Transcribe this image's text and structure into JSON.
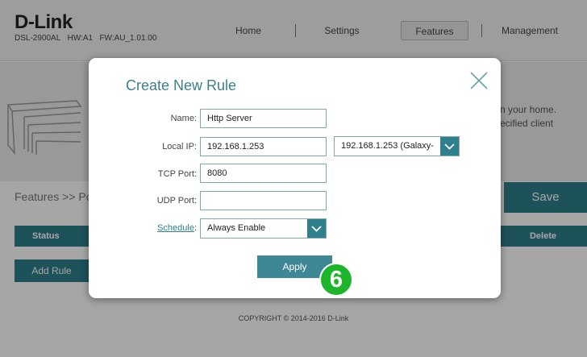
{
  "brand": {
    "name": "D-Link",
    "model": "DSL-2900AL",
    "hw": "HW:A1",
    "fw": "FW:AU_1.01.00"
  },
  "nav": {
    "home": "Home",
    "settings": "Settings",
    "features": "Features",
    "management": "Management"
  },
  "hero": {
    "text_line1": "n your home.",
    "text_line2": "ecified client"
  },
  "page": {
    "breadcrumb": "Features >> Po",
    "save_label": "Save",
    "col_status": "Status",
    "col_delete": "Delete",
    "add_rule_label": "Add Rule",
    "copyright": "COPYRIGHT © 2014-2016 D-Link"
  },
  "modal": {
    "title": "Create New Rule",
    "name_label": "Name:",
    "name_value": "Http Server",
    "local_ip_label": "Local IP:",
    "local_ip_value": "192.168.1.253",
    "local_ip_select": "192.168.1.253 (Galaxy-",
    "tcp_label": "TCP Port:",
    "tcp_value": "8080",
    "udp_label": "UDP Port:",
    "udp_value": "",
    "schedule_label": "Schedule",
    "schedule_colon": ":",
    "schedule_value": "Always Enable",
    "apply_label": "Apply"
  },
  "step_badge": "6",
  "colors": {
    "accent": "#2f7f8c",
    "title": "#3d7f8c",
    "badge": "#1db52a"
  },
  "icons": {
    "close": "close-icon",
    "dropdown": "chevron-down-icon"
  }
}
